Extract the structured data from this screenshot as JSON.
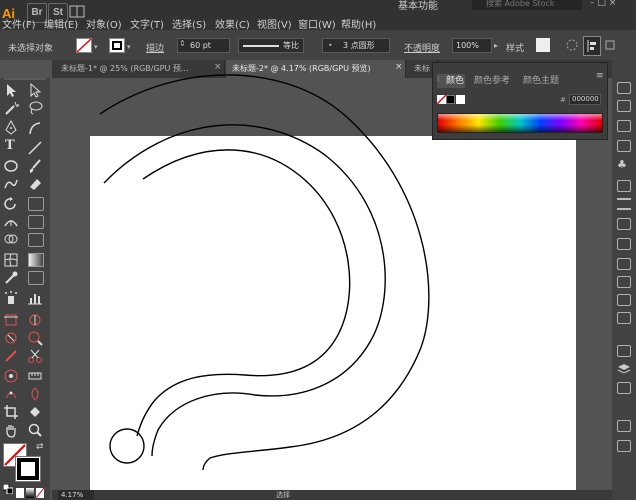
{
  "app": {
    "logo": "Ai"
  },
  "menubar": {
    "apps": [
      "Br",
      "St"
    ],
    "items": [
      "文件(F)",
      "编辑(E)",
      "对象(O)",
      "文字(T)",
      "选择(S)",
      "效果(C)",
      "视图(V)",
      "窗口(W)",
      "帮助(H)"
    ],
    "workspace": "基本功能",
    "search_placeholder": "搜索 Adobe Stock"
  },
  "controlbar": {
    "selection_status": "未选择对象",
    "stroke_label": "描边",
    "stroke_value": "60 pt",
    "profile_label": "等比",
    "brush_value": "3 点圆形",
    "opacity_label": "不透明度",
    "opacity_value": "100%",
    "style_label": "样式"
  },
  "tabs": [
    {
      "label": "未标题-1* @ 25% (RGB/GPU 预..."
    },
    {
      "label": "未标题-2* @ 4.17% (RGB/GPU 预览)"
    },
    {
      "label": "未标"
    }
  ],
  "color_panel": {
    "tabs": [
      "颜色",
      "颜色参考",
      "颜色主题"
    ],
    "hex_value": "000000"
  },
  "statusbar": {
    "zoom": "4.17%",
    "center_label": "选择"
  },
  "colors": {
    "accent": "#ff9a00",
    "canvas": "#ffffff",
    "stroke": "#000000"
  }
}
